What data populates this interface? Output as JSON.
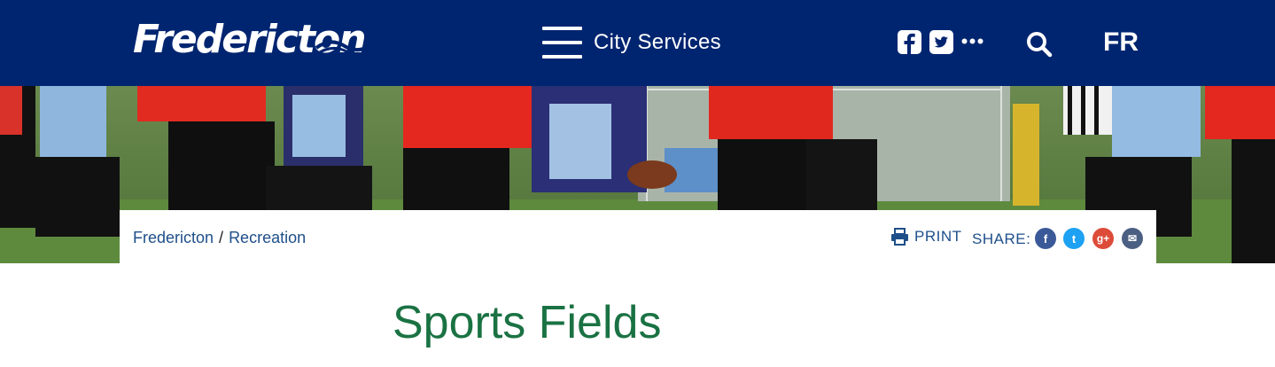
{
  "header": {
    "logo_text": "Fredericton",
    "menu_label": "City Services",
    "language_label": "FR",
    "icons": [
      "facebook-icon",
      "twitter-icon",
      "more-icon",
      "search-icon"
    ]
  },
  "hero": {
    "description_icon": "football-photo"
  },
  "breadcrumb": {
    "items": [
      "Fredericton",
      "Recreation"
    ],
    "separator": "/"
  },
  "tools": {
    "print_label": "PRINT",
    "share_label": "SHARE:",
    "share_icons": [
      {
        "name": "facebook",
        "glyph": "f",
        "color": "#3b5998"
      },
      {
        "name": "twitter",
        "glyph": "t",
        "color": "#1da1f2"
      },
      {
        "name": "google-plus",
        "glyph": "g+",
        "color": "#dd4b39"
      },
      {
        "name": "email",
        "glyph": "✉",
        "color": "#4b5f83"
      }
    ]
  },
  "page": {
    "title": "Sports Fields"
  },
  "colors": {
    "header_bg": "#002570",
    "link": "#1e4f8a",
    "title": "#1a7243"
  }
}
